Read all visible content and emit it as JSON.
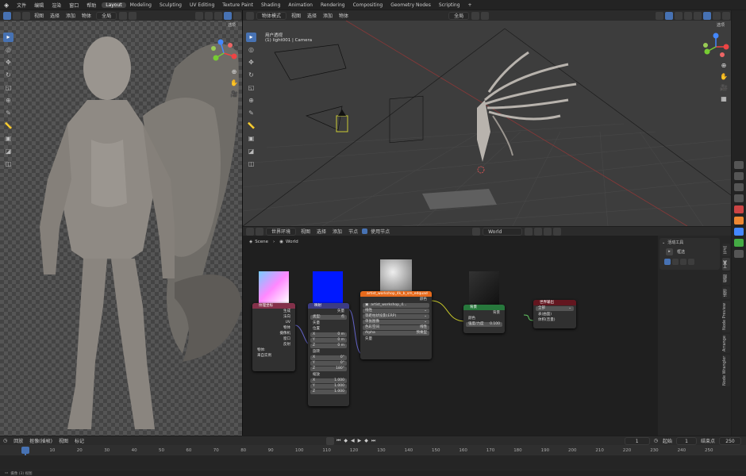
{
  "topbar": {
    "menus": [
      "文件",
      "编辑",
      "渲染",
      "窗口",
      "帮助"
    ],
    "workspaces": [
      "Layout",
      "Modeling",
      "Sculpting",
      "UV Editing",
      "Texture Paint",
      "Shading",
      "Animation",
      "Rendering",
      "Compositing",
      "Geometry Nodes",
      "Scripting"
    ],
    "active_workspace": "Layout",
    "add_tab": "+"
  },
  "left_viewport": {
    "menus": [
      "视图",
      "选择",
      "添加",
      "物体"
    ],
    "transform": "全局",
    "options_label": "选项"
  },
  "right_viewport": {
    "mode": "物体模式",
    "menus": [
      "视图",
      "选择",
      "添加",
      "物体"
    ],
    "transform": "全局",
    "options_label": "选项",
    "view_name": "用户透视",
    "view_info": "(1) light001 | Camera"
  },
  "node_editor": {
    "type_label": "世界环境",
    "menus": [
      "视图",
      "选择",
      "添加",
      "节点"
    ],
    "use_nodes_label": "使用节点",
    "slot_name": "World",
    "breadcrumb": [
      "Scene",
      "World"
    ],
    "nodes": {
      "texcoord": {
        "title": "纹理坐标",
        "outputs": [
          "生成",
          "法向",
          "UV",
          "物体",
          "摄像机",
          "窗口",
          "反射"
        ],
        "object_label": "物体:",
        "from_instancer": "来自实例"
      },
      "mapping": {
        "title": "映射",
        "output": "矢量",
        "type_label": "类型:",
        "type_value": "点",
        "vector_label": "矢量",
        "location_label": "位置",
        "location": [
          [
            "X",
            "0 m"
          ],
          [
            "Y",
            "0 m"
          ],
          [
            "Z",
            "0 m"
          ]
        ],
        "rotation_label": "旋转",
        "rotation": [
          [
            "X",
            "0°"
          ],
          [
            "Y",
            "0°"
          ],
          [
            "Z",
            "180°"
          ]
        ],
        "scale_label": "缩放",
        "scale": [
          [
            "X",
            "1.000"
          ],
          [
            "Y",
            "1.000"
          ],
          [
            "Z",
            "1.000"
          ]
        ]
      },
      "envtex": {
        "title": "artist_workshop_4k_b_sm_edquad",
        "output": "颜色",
        "image_name": "artist_workshop_4...",
        "dropdowns": [
          "线性",
          "等距柱状投影(ERP)",
          "单张图像"
        ],
        "colorspace_label": "色彩空间",
        "colorspace": "线性",
        "alpha_label": "Alpha",
        "alpha": "预乘型",
        "vector_label": "矢量"
      },
      "background": {
        "title": "背景",
        "output": "背景",
        "color_label": "颜色",
        "strength_label": "强度/力度",
        "strength": "0.100"
      },
      "output": {
        "title": "世界输出",
        "target": "全部",
        "inputs": [
          "表(曲面)",
          "体积(音量)"
        ]
      }
    }
  },
  "sidebar": {
    "header": "活动工具",
    "tool_name": "框选",
    "tabs": [
      "节点",
      "工具",
      "视图",
      "选项",
      "Node Preview",
      "Arrange",
      "Node Wrangler"
    ]
  },
  "timeline": {
    "menus": [
      "回放",
      "抠像(插帧)",
      "视图",
      "标记"
    ],
    "current_frame": "1",
    "start_label": "起始",
    "start": "1",
    "end_label": "结束点",
    "end": "250",
    "ticks": [
      "1",
      "10",
      "20",
      "30",
      "40",
      "50",
      "60",
      "70",
      "80",
      "90",
      "100",
      "110",
      "120",
      "130",
      "140",
      "150",
      "160",
      "170",
      "180",
      "190",
      "200",
      "210",
      "220",
      "230",
      "240",
      "250"
    ]
  },
  "statusbar": {
    "text": "摄像 (3) 视图"
  },
  "colors": {
    "accent": "#4772b3",
    "texcoord_header": "#83314a",
    "mapping_header": "#3c3c83",
    "texture_header": "#e66a1c",
    "background_header": "#27783c",
    "output_header": "#63161f"
  }
}
